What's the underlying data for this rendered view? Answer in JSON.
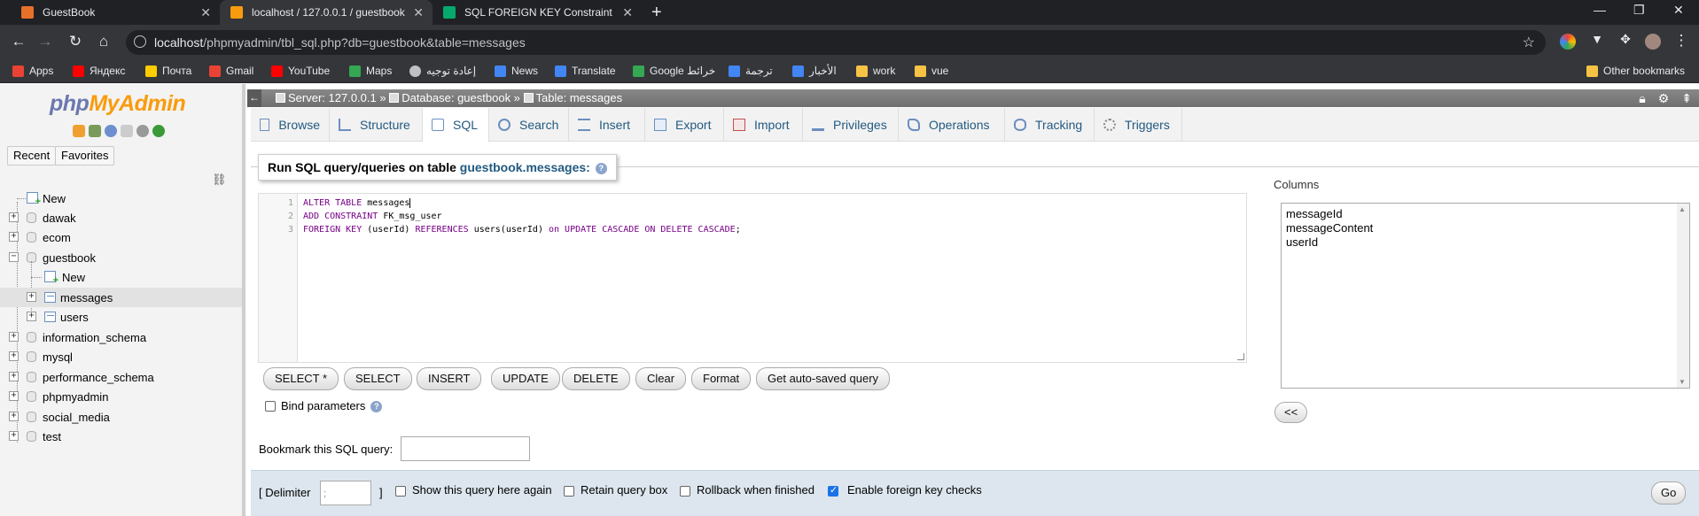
{
  "browser": {
    "tabs": [
      {
        "title": "GuestBook",
        "icon": "guestbook-favicon",
        "color": "#e8712a"
      },
      {
        "title": "localhost / 127.0.0.1 / guestbook",
        "icon": "phpmyadmin-favicon",
        "color": "#f89c0e"
      },
      {
        "title": "SQL FOREIGN KEY Constraint",
        "icon": "w3schools-favicon",
        "color": "#04aa6d"
      }
    ],
    "url_host": "localhost",
    "url_path": "/phpmyadmin/tbl_sql.php?db=guestbook&table=messages",
    "bookmarks": [
      {
        "label": "Apps",
        "color": "#ea4335"
      },
      {
        "label": "Яндекс",
        "color": "#ff0000"
      },
      {
        "label": "Почта",
        "color": "#ffcc00"
      },
      {
        "label": "Gmail",
        "color": "#ea4335"
      },
      {
        "label": "YouTube",
        "color": "#ff0000"
      },
      {
        "label": "Maps",
        "color": "#34a853"
      },
      {
        "label": "إعادة توجيه",
        "color": "#bdc1c6"
      },
      {
        "label": "News",
        "color": "#4285f4"
      },
      {
        "label": "Translate",
        "color": "#4285f4"
      },
      {
        "label": "Google خرائط",
        "color": "#34a853"
      },
      {
        "label": "ترجمة",
        "color": "#4285f4"
      },
      {
        "label": "الأخبار",
        "color": "#4285f4"
      },
      {
        "label": "work",
        "color": "#f6c344"
      },
      {
        "label": "vue",
        "color": "#f6c344"
      }
    ],
    "other_bookmarks": "Other bookmarks"
  },
  "pma": {
    "logo_php": "php",
    "logo_myadmin": "MyAdmin",
    "recent": "Recent",
    "favorites": "Favorites",
    "tree": {
      "new": "New",
      "databases": [
        "dawak",
        "ecom",
        "guestbook",
        "information_schema",
        "mysql",
        "performance_schema",
        "phpmyadmin",
        "social_media",
        "test"
      ],
      "guestbook_new": "New",
      "tables": [
        "messages",
        "users"
      ]
    },
    "breadcrumb": {
      "server": "Server: 127.0.0.1 »",
      "database": "Database: guestbook »",
      "table": "Table: messages"
    },
    "tabs": [
      "Browse",
      "Structure",
      "SQL",
      "Search",
      "Insert",
      "Export",
      "Import",
      "Privileges",
      "Operations",
      "Tracking",
      "Triggers"
    ],
    "legend_prefix": "Run SQL query/queries on table ",
    "legend_table": "guestbook.messages:",
    "query_lines": [
      {
        "kw1": "ALTER TABLE",
        "rest": " messages"
      },
      {
        "kw1": "ADD CONSTRAINT",
        "rest": " FK_msg_user"
      },
      {
        "kw1": "FOREIGN KEY",
        "rest": " (userId) ",
        "kw2": "REFERENCES",
        "rest2": " users(userId) ",
        "kw3": "on UPDATE CASCADE ON DELETE CASCADE",
        "rest3": ";"
      }
    ],
    "query_buttons": [
      "SELECT *",
      "SELECT",
      "INSERT",
      "UPDATE",
      "DELETE",
      "Clear",
      "Format",
      "Get auto-saved query"
    ],
    "bind_parameters": "Bind parameters",
    "bookmark_label": "Bookmark this SQL query:",
    "columns_label": "Columns",
    "columns": [
      "messageId",
      "messageContent",
      "userId"
    ],
    "insert_button": "<<",
    "footer": {
      "delimiter_open": "[ Delimiter",
      "delimiter_value": ";",
      "delimiter_close": "]",
      "show_query_again": "Show this query here again",
      "retain_query_box": "Retain query box",
      "rollback_when_finished": "Rollback when finished",
      "enable_fk_checks": "Enable foreign key checks",
      "enable_fk_checked": true,
      "go": "Go"
    }
  }
}
